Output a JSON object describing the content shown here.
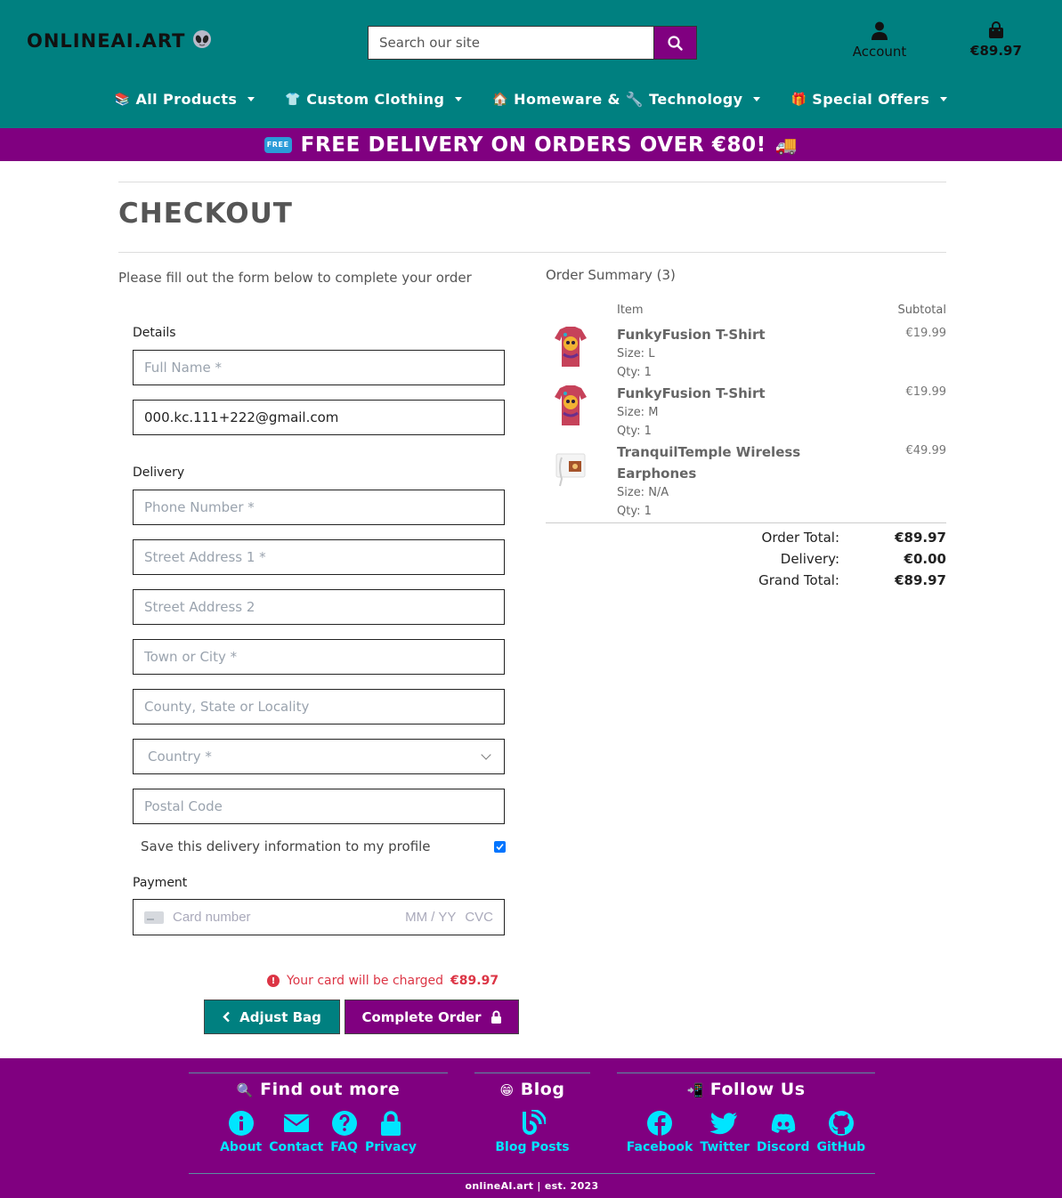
{
  "header": {
    "logo": "ONLINEAI.ART",
    "search_placeholder": "Search our site",
    "account_label": "Account",
    "bag_total": "€89.97"
  },
  "nav": [
    {
      "emoji": "📚",
      "label": "All Products"
    },
    {
      "emoji": "👕",
      "label": "Custom Clothing"
    },
    {
      "emoji": "🏠",
      "label": "Homeware & 🔧 Technology"
    },
    {
      "emoji": "🎁",
      "label": "Special Offers"
    }
  ],
  "promo": {
    "badge": "FREE",
    "text": "FREE DELIVERY ON ORDERS OVER €80!",
    "truck": "🚚"
  },
  "page": {
    "title": "CHECKOUT",
    "intro": "Please fill out the form below to complete your order"
  },
  "form": {
    "details_label": "Details",
    "full_name_placeholder": "Full Name *",
    "email_value": "000.kc.111+222@gmail.com",
    "delivery_label": "Delivery",
    "phone_placeholder": "Phone Number *",
    "street1_placeholder": "Street Address 1 *",
    "street2_placeholder": "Street Address 2",
    "town_placeholder": "Town or City *",
    "county_placeholder": "County, State or Locality",
    "country_selected": "Country *",
    "postcode_placeholder": "Postal Code",
    "save_info_label": "Save this delivery information to my profile",
    "save_info_checked": true,
    "payment_label": "Payment",
    "card_placeholder": "Card number",
    "card_expiry_placeholder": "MM / YY",
    "card_cvc_placeholder": "CVC",
    "charge_text": "Your card will be charged",
    "charge_amount": "€89.97",
    "adjust_bag_label": "Adjust Bag",
    "complete_order_label": "Complete Order"
  },
  "summary": {
    "title": "Order Summary (3)",
    "col_item": "Item",
    "col_subtotal": "Subtotal",
    "items": [
      {
        "name": "FunkyFusion T-Shirt",
        "size": "Size: L",
        "qty": "Qty: 1",
        "price": "€19.99"
      },
      {
        "name": "FunkyFusion T-Shirt",
        "size": "Size: M",
        "qty": "Qty: 1",
        "price": "€19.99"
      },
      {
        "name": "TranquilTemple Wireless Earphones",
        "size": "Size: N/A",
        "qty": "Qty: 1",
        "price": "€49.99"
      }
    ],
    "order_total_label": "Order Total:",
    "order_total": "€89.97",
    "delivery_label": "Delivery:",
    "delivery": "€0.00",
    "grand_total_label": "Grand Total:",
    "grand_total": "€89.97"
  },
  "footer": {
    "find_title": "Find out more",
    "find_emoji": "🔍",
    "blog_title": "Blog",
    "blog_emoji": "😁",
    "follow_title": "Follow Us",
    "follow_emoji": "📲",
    "links_find": [
      "About",
      "Contact",
      "FAQ",
      "Privacy"
    ],
    "blog_posts_label": "Blog Posts",
    "links_follow": [
      "Facebook",
      "Twitter",
      "Discord",
      "GitHub"
    ],
    "copyright": "onlineAI.art | est. 2023"
  },
  "colors": {
    "header_teal": "#008080",
    "accent_purple": "#800080",
    "footer_link_cyan": "#00e5ff",
    "error_red": "#dc3545"
  }
}
